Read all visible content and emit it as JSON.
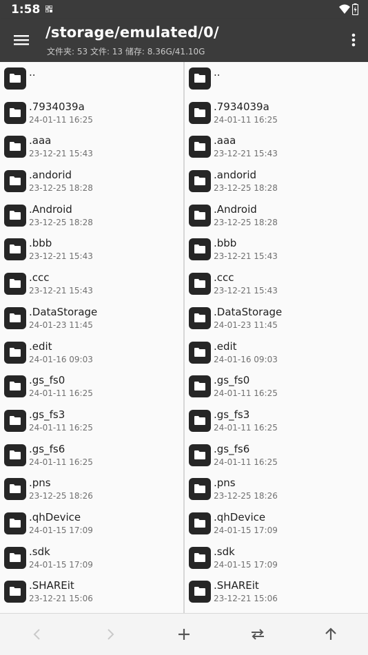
{
  "status": {
    "time": "1:58"
  },
  "appbar": {
    "path": "/storage/emulated/0/",
    "summary": "文件夹: 53  文件: 13  储存: 8.36G/41.10G"
  },
  "colors": {
    "bar_bg": "#3b3b3b",
    "icon_bg": "#262626"
  },
  "left_pane": {
    "files": [
      {
        "name": "..",
        "date": ""
      },
      {
        "name": ".7934039a",
        "date": "24-01-11 16:25"
      },
      {
        "name": ".aaa",
        "date": "23-12-21 15:43"
      },
      {
        "name": ".andorid",
        "date": "23-12-25 18:28"
      },
      {
        "name": ".Android",
        "date": "23-12-25 18:28"
      },
      {
        "name": ".bbb",
        "date": "23-12-21 15:43"
      },
      {
        "name": ".ccc",
        "date": "23-12-21 15:43"
      },
      {
        "name": ".DataStorage",
        "date": "24-01-23 11:45"
      },
      {
        "name": ".edit",
        "date": "24-01-16 09:03"
      },
      {
        "name": ".gs_fs0",
        "date": "24-01-11 16:25"
      },
      {
        "name": ".gs_fs3",
        "date": "24-01-11 16:25"
      },
      {
        "name": ".gs_fs6",
        "date": "24-01-11 16:25"
      },
      {
        "name": ".pns",
        "date": "23-12-25 18:26"
      },
      {
        "name": ".qhDevice",
        "date": "24-01-15 17:09"
      },
      {
        "name": ".sdk",
        "date": "24-01-15 17:09"
      },
      {
        "name": ".SHAREit",
        "date": "23-12-21 15:06"
      }
    ]
  },
  "right_pane": {
    "files": [
      {
        "name": "..",
        "date": ""
      },
      {
        "name": ".7934039a",
        "date": "24-01-11 16:25"
      },
      {
        "name": ".aaa",
        "date": "23-12-21 15:43"
      },
      {
        "name": ".andorid",
        "date": "23-12-25 18:28"
      },
      {
        "name": ".Android",
        "date": "23-12-25 18:28"
      },
      {
        "name": ".bbb",
        "date": "23-12-21 15:43"
      },
      {
        "name": ".ccc",
        "date": "23-12-21 15:43"
      },
      {
        "name": ".DataStorage",
        "date": "24-01-23 11:45"
      },
      {
        "name": ".edit",
        "date": "24-01-16 09:03"
      },
      {
        "name": ".gs_fs0",
        "date": "24-01-11 16:25"
      },
      {
        "name": ".gs_fs3",
        "date": "24-01-11 16:25"
      },
      {
        "name": ".gs_fs6",
        "date": "24-01-11 16:25"
      },
      {
        "name": ".pns",
        "date": "23-12-25 18:26"
      },
      {
        "name": ".qhDevice",
        "date": "24-01-15 17:09"
      },
      {
        "name": ".sdk",
        "date": "24-01-15 17:09"
      },
      {
        "name": ".SHAREit",
        "date": "23-12-21 15:06"
      }
    ]
  },
  "bottom_bar": {
    "icons": [
      "back-icon",
      "forward-icon",
      "add-icon",
      "swap-icon",
      "up-icon"
    ]
  }
}
